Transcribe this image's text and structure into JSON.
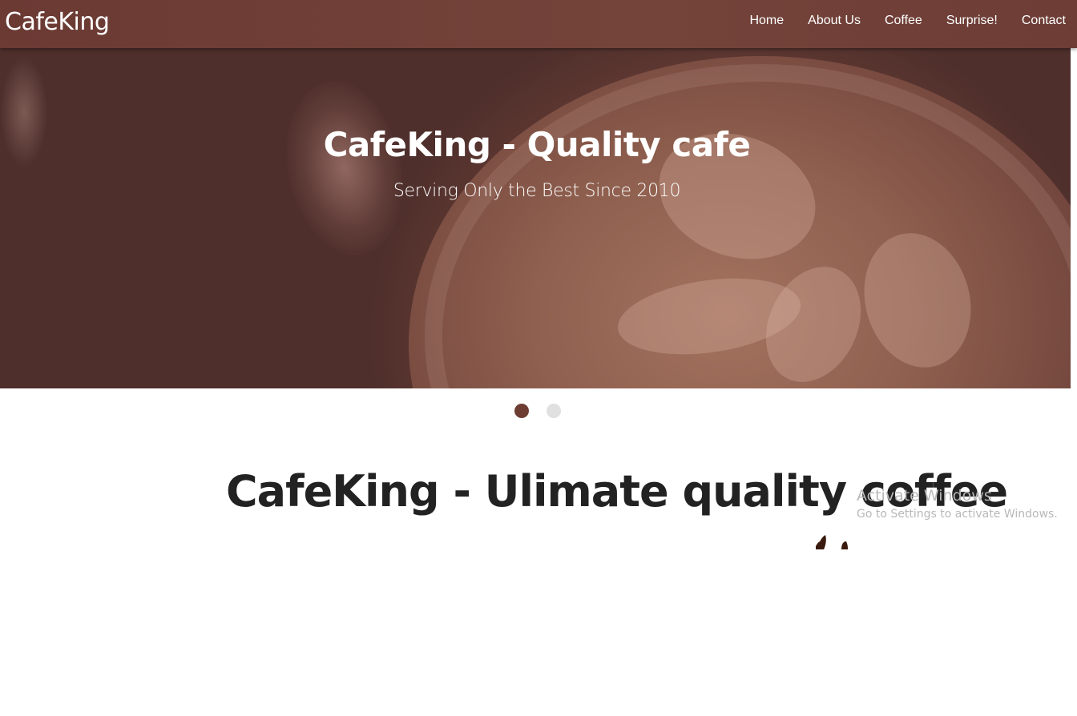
{
  "navbar": {
    "brand": "CafeKing",
    "links": [
      "Home",
      "About Us",
      "Coffee",
      "Surprise!",
      "Contact"
    ],
    "background_color": "#6e3e36"
  },
  "hero": {
    "title": "CafeKing - Quality cafe",
    "subtitle": "Serving Only the Best Since 2010",
    "image": "latte-art-coffee-cup"
  },
  "carousel": {
    "slide_count": 2,
    "active_index": 0,
    "active_color": "#6d3d34",
    "inactive_color": "#e0e0e0"
  },
  "main": {
    "heading": "CafeKing - Ulimate quality coffee"
  },
  "watermark": {
    "title": "Activate Windows",
    "subtitle": "Go to Settings to activate Windows."
  }
}
